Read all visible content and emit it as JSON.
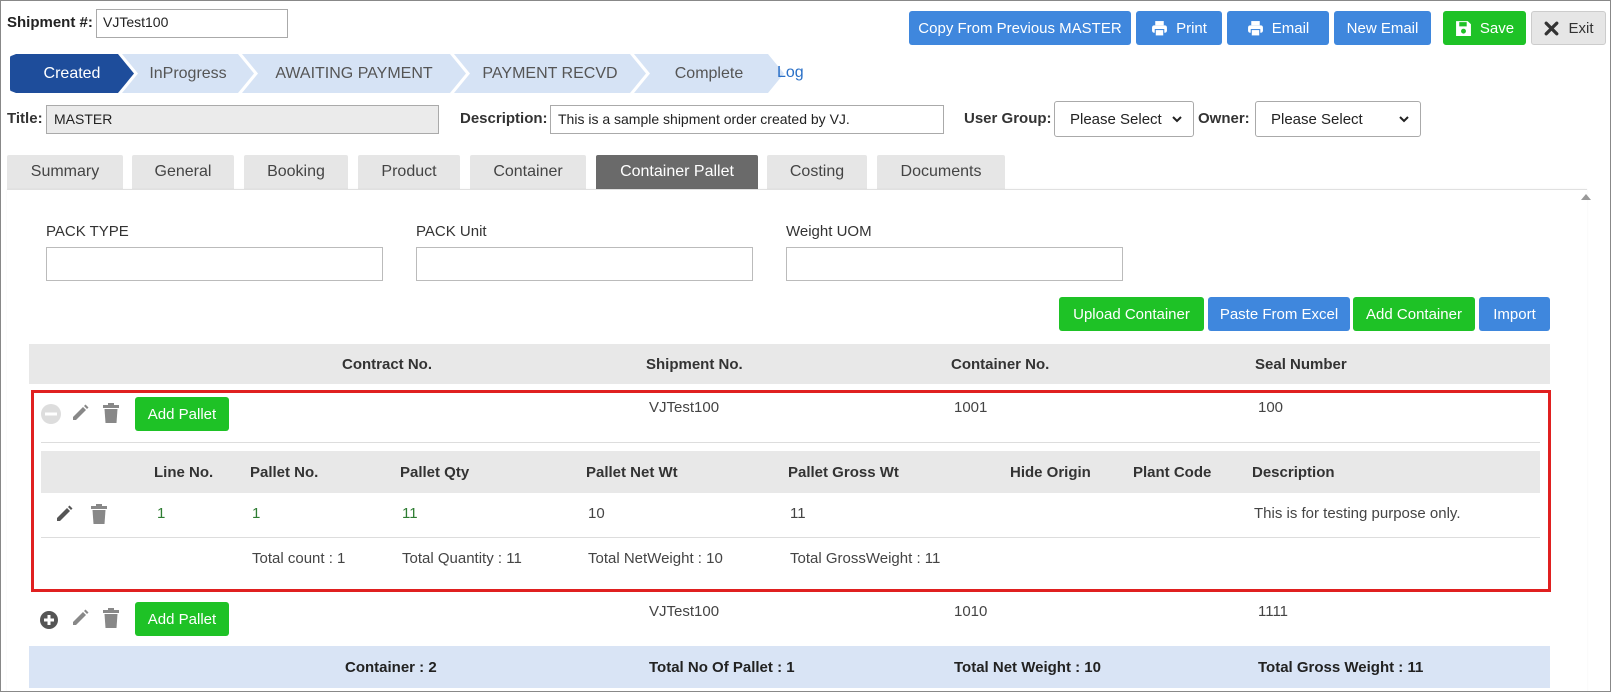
{
  "header": {
    "shipment_label": "Shipment #:",
    "shipment_value": "VJTest100",
    "buttons": {
      "copy": "Copy From Previous MASTER",
      "print": "Print",
      "email": "Email",
      "new_email": "New Email",
      "save": "Save",
      "exit": "Exit"
    }
  },
  "status_steps": [
    "Created",
    "InProgress",
    "AWAITING PAYMENT",
    "PAYMENT RECVD",
    "Complete"
  ],
  "active_step": "Created",
  "log_link": "Log",
  "title_row": {
    "title_label": "Title:",
    "title_value": "MASTER",
    "description_label": "Description:",
    "description_value": "This is a sample shipment order created by VJ.",
    "user_group_label": "User Group:",
    "user_group_value": "Please Select",
    "owner_label": "Owner:",
    "owner_value": "Please Select"
  },
  "tabs": [
    "Summary",
    "General",
    "Booking",
    "Product",
    "Container",
    "Container Pallet",
    "Costing",
    "Documents"
  ],
  "active_tab": "Container Pallet",
  "filters": {
    "pack_type_label": "PACK TYPE",
    "pack_unit_label": "PACK Unit",
    "weight_uom_label": "Weight UOM"
  },
  "actions": {
    "upload": "Upload Container",
    "paste": "Paste From Excel",
    "add": "Add Container",
    "import": "Import"
  },
  "container_table": {
    "headers": [
      "Contract No.",
      "Shipment No.",
      "Container No.",
      "Seal Number"
    ],
    "add_pallet_label": "Add Pallet",
    "rows": [
      {
        "contract": "",
        "shipment": "VJTest100",
        "container": "1001",
        "seal": "100",
        "expanded": true
      },
      {
        "contract": "",
        "shipment": "VJTest100",
        "container": "1010",
        "seal": "1111",
        "expanded": false
      }
    ]
  },
  "pallet_table": {
    "headers": [
      "Line No.",
      "Pallet No.",
      "Pallet Qty",
      "Pallet Net Wt",
      "Pallet Gross Wt",
      "Hide Origin",
      "Plant Code",
      "Description"
    ],
    "rows": [
      {
        "line": "1",
        "pallet": "1",
        "qty": "11",
        "net": "10",
        "gross": "11",
        "hide_origin": "",
        "plant_code": "",
        "description": "This is for testing purpose only."
      }
    ],
    "totals": {
      "count": "Total count : 1",
      "quantity": "Total Quantity : 11",
      "net": "Total NetWeight : 10",
      "gross": "Total GrossWeight : 11"
    }
  },
  "footer": {
    "containers": "Container : 2",
    "pallets": "Total No Of Pallet : 1",
    "net": "Total Net Weight : 10",
    "gross": "Total Gross Weight : 11"
  }
}
